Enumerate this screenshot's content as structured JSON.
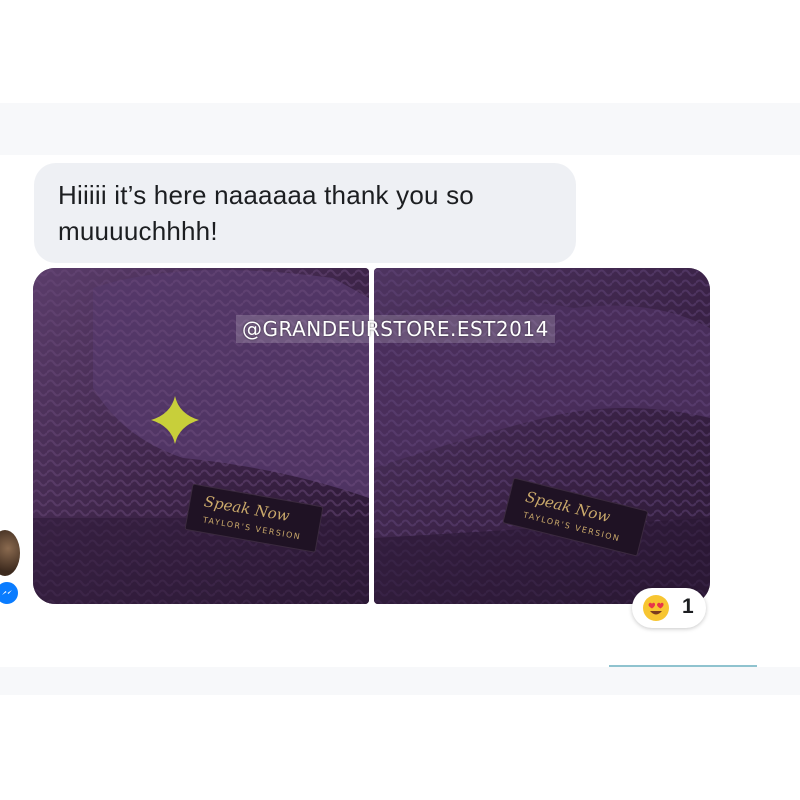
{
  "message": {
    "text": "Hiiiii it’s here naaaaaa thank you so muuuuchhhh!"
  },
  "watermark": {
    "text": "@GRANDEURSTORE.EST2014"
  },
  "photos": {
    "left_label": "Speak Now TAYLOR'S VERSION",
    "right_label": "Speak Now TAYLOR'S VERSION"
  },
  "reaction": {
    "emoji": "heart-eyes-emoji",
    "count": "1"
  },
  "colors": {
    "bubble": "#eef0f4",
    "messenger_blue": "#0a7cff",
    "sweater_purple": "#3a2342"
  }
}
